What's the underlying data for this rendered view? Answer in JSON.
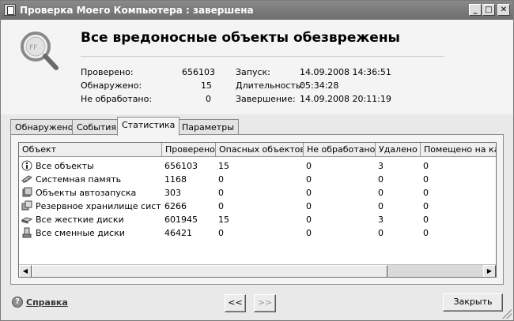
{
  "window": {
    "title": "Проверка Моего Компьютера : завершена",
    "controls": {
      "minimize": "_",
      "maximize": "□",
      "close": "✕"
    }
  },
  "header": {
    "heading": "Все вредоносные объекты обезврежены",
    "stats_left": [
      {
        "label": "Проверено:",
        "value": "656103"
      },
      {
        "label": "Обнаружено:",
        "value": "15"
      },
      {
        "label": "Не обработано:",
        "value": "0"
      }
    ],
    "stats_right": [
      {
        "label": "Запуск:",
        "value": "14.09.2008 14:36:51"
      },
      {
        "label": "Длительность:",
        "value": "05:34:28"
      },
      {
        "label": "Завершение:",
        "value": "14.09.2008 20:11:19"
      }
    ]
  },
  "tabs": [
    {
      "label": "Обнаружено",
      "active": false
    },
    {
      "label": "События",
      "active": false
    },
    {
      "label": "Статистика",
      "active": true
    },
    {
      "label": "Параметры",
      "active": false
    }
  ],
  "table": {
    "columns": [
      "Объект",
      "Проверено",
      "Опасных объектов",
      "Не обработано",
      "Удалено",
      "Помещено на кар"
    ],
    "rows": [
      {
        "icon": "info-icon",
        "cells": [
          "Все объекты",
          "656103",
          "15",
          "0",
          "3",
          "0"
        ]
      },
      {
        "icon": "memory-icon",
        "cells": [
          "Системная память",
          "1168",
          "0",
          "0",
          "0",
          "0"
        ]
      },
      {
        "icon": "autorun-icon",
        "cells": [
          "Объекты автозапуска",
          "303",
          "0",
          "0",
          "0",
          "0"
        ]
      },
      {
        "icon": "backup-storage-icon",
        "cells": [
          "Резервное хранилище сист…",
          "6266",
          "0",
          "0",
          "0",
          "0"
        ]
      },
      {
        "icon": "hard-disk-icon",
        "cells": [
          "Все жесткие диски",
          "601945",
          "15",
          "0",
          "3",
          "0"
        ]
      },
      {
        "icon": "removable-disk-icon",
        "cells": [
          "Все сменные диски",
          "46421",
          "0",
          "0",
          "0",
          "0"
        ]
      }
    ]
  },
  "footer": {
    "help_label": "Справка",
    "prev_label": "<<",
    "next_label": ">>",
    "close_label": "Закрыть"
  }
}
